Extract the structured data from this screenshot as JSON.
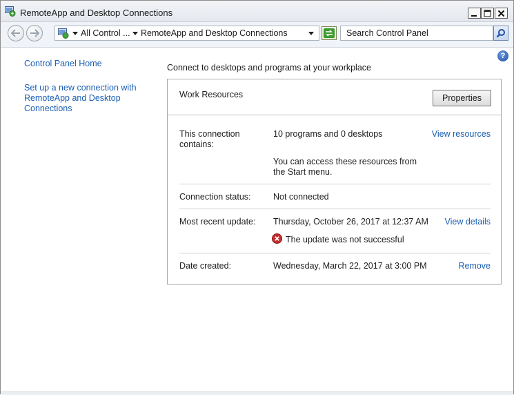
{
  "window": {
    "title": "RemoteApp and Desktop Connections"
  },
  "navigation": {
    "breadcrumb_root": "All Control ...",
    "breadcrumb_current": "RemoteApp and Desktop Connections",
    "search_placeholder": "Search Control Panel"
  },
  "help": {
    "label": "?"
  },
  "sidebar": {
    "home_link": "Control Panel Home",
    "setup_link": "Set up a new connection with RemoteApp and Desktop Connections"
  },
  "main": {
    "heading": "Connect to desktops and programs at your workplace",
    "connection": {
      "name": "Work Resources",
      "properties_button": "Properties",
      "contains_label": "This connection contains:",
      "contains_value": "10 programs and 0 desktops",
      "view_resources_link": "View resources",
      "access_note": "You can access these resources from the Start menu.",
      "status_label": "Connection status:",
      "status_value": "Not connected",
      "update_label": "Most recent update:",
      "update_value": "Thursday, October 26, 2017 at 12:37 AM",
      "view_details_link": "View details",
      "update_error": "The update was not successful",
      "created_label": "Date created:",
      "created_value": "Wednesday, March 22, 2017 at 3:00 PM",
      "remove_link": "Remove"
    }
  }
}
